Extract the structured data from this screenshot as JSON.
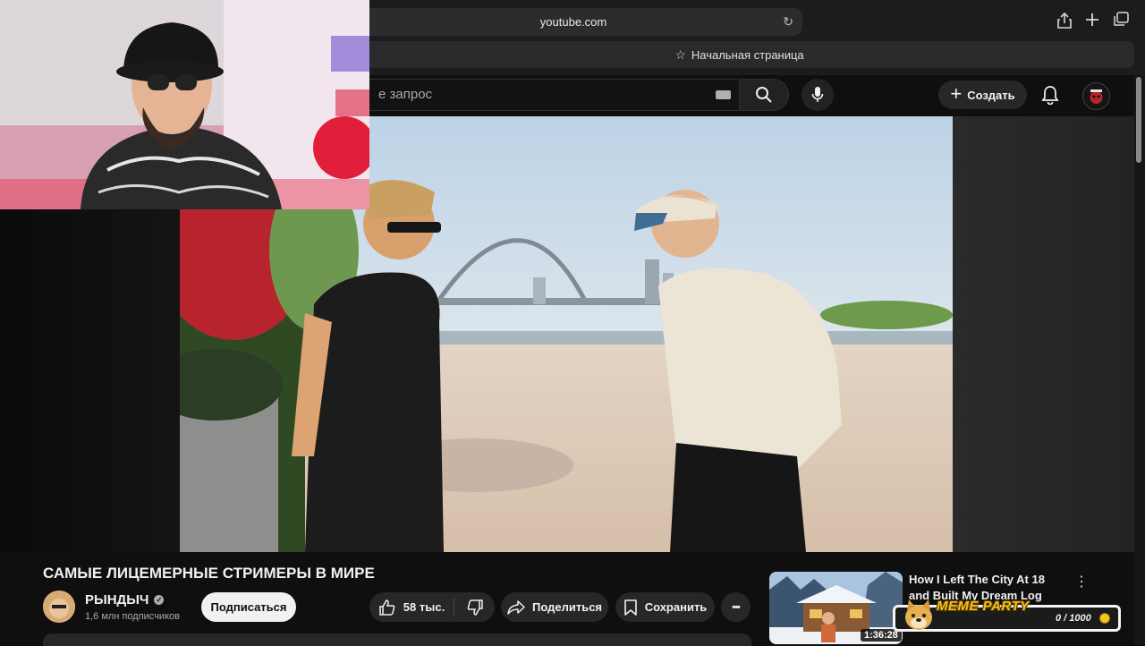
{
  "browser": {
    "url": "youtube.com",
    "tab_title": "Начальная страница",
    "icons": [
      "reload-icon",
      "share-icon",
      "plus-icon",
      "tabs-icon",
      "star-icon"
    ]
  },
  "youtube_header": {
    "search_placeholder": "е запрос",
    "create_label": "Создать",
    "icons": [
      "keyboard-icon",
      "search-icon",
      "mic-icon",
      "bell-icon",
      "avatar"
    ]
  },
  "video": {
    "title": "САМЫЕ ЛИЦЕМЕРНЫЕ СТРИМЕРЫ В МИРЕ",
    "channel_name": "РЫНДЫЧ",
    "subscribers": "1,6 млн подписчиков",
    "subscribe_label": "Подписаться",
    "likes": "58 тыс.",
    "share_label": "Поделиться",
    "save_label": "Сохранить",
    "more_label": "•••"
  },
  "recommendation": {
    "title": "How I Left The City At 18 and Built My Dream Log Cabin",
    "duration": "1:36:28",
    "menu_label": "⋮"
  },
  "meme_widget": {
    "title": "MEME PARTY",
    "progress": "0 / 1000",
    "progress_fraction": 0
  },
  "colors": {
    "background": "#0f0f0f",
    "pill": "#272727",
    "subscribe": "#f1f1f1",
    "meme_title": "#f7c21c"
  }
}
